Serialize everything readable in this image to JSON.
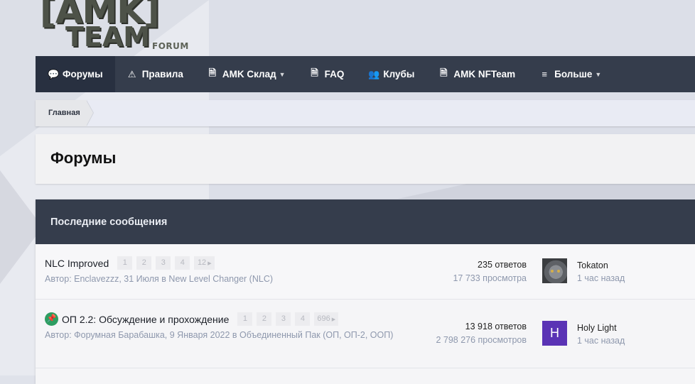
{
  "logo": {
    "big": "[AMK]",
    "team": "TEAM",
    "sub": "FORUM"
  },
  "nav": [
    {
      "label": "Форумы",
      "icon": "comments-icon"
    },
    {
      "label": "Правила",
      "icon": "warning-icon"
    },
    {
      "label": "AMK Склад",
      "icon": "document-icon",
      "dropdown": true
    },
    {
      "label": "FAQ",
      "icon": "document-icon"
    },
    {
      "label": "Клубы",
      "icon": "users-icon"
    },
    {
      "label": "AMK NFTeam",
      "icon": "document-icon"
    },
    {
      "label": "Больше",
      "icon": "menu-icon",
      "dropdown": true
    }
  ],
  "breadcrumb": {
    "home": "Главная"
  },
  "page": {
    "title": "Форумы"
  },
  "block": {
    "title": "Последние сообщения"
  },
  "topics": [
    {
      "title": "NLC Improved",
      "pinned": false,
      "pages": [
        "1",
        "2",
        "3",
        "4",
        "12"
      ],
      "meta": "Автор: Enclavezzz, 31 Июля в New Level Changer (NLC)",
      "replies": "235 ответов",
      "views": "17 733 просмотра",
      "last_user": "Tokaton",
      "last_time": "1 час назад",
      "avatar_letter": ""
    },
    {
      "title": "ОП 2.2: Обсуждение и прохождение",
      "pinned": true,
      "pages": [
        "1",
        "2",
        "3",
        "4",
        "696"
      ],
      "meta": "Автор: Форумная Барабашка, 9 Января 2022 в Объединенный Пак (ОП, ОП-2, ООП)",
      "replies": "13 918 ответов",
      "views": "2 798 276 просмотров",
      "last_user": "Holy Light",
      "last_time": "1 час назад",
      "avatar_letter": "H"
    }
  ],
  "colors": {
    "nav_bg": "#353d4c",
    "nav_active": "#283040",
    "pin": "#2d9d61",
    "avatar_h": "#5a33b5"
  }
}
